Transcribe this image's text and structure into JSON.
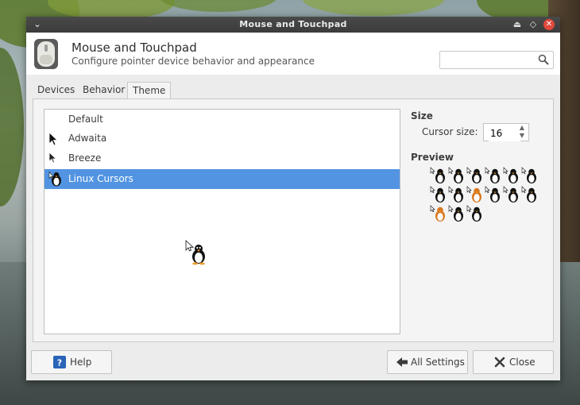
{
  "window": {
    "title": "Mouse and Touchpad"
  },
  "header": {
    "title": "Mouse and Touchpad",
    "subtitle": "Configure pointer device behavior and appearance",
    "search_value": "",
    "icon": "mouse-icon"
  },
  "tabs": [
    {
      "label": "Devices",
      "active": false
    },
    {
      "label": "Behavior",
      "active": false
    },
    {
      "label": "Theme",
      "active": true
    }
  ],
  "themes": [
    {
      "label": "Default",
      "cursor_icon": "none",
      "selected": false
    },
    {
      "label": "Adwaita",
      "cursor_icon": "arrow-cursor-icon",
      "selected": false
    },
    {
      "label": "Breeze",
      "cursor_icon": "arrow-cursor-icon",
      "selected": false
    },
    {
      "label": "Linux Cursors",
      "cursor_icon": "penguin-cursor-icon",
      "selected": true
    }
  ],
  "side": {
    "size_heading": "Size",
    "cursor_size_label": "Cursor size:",
    "cursor_size_value": "16",
    "preview_heading": "Preview"
  },
  "footer": {
    "help_label": "Help",
    "all_settings_label": "All Settings",
    "close_label": "Close"
  },
  "colors": {
    "selection": "#5294e2",
    "titlebar": "#3b3b3b",
    "close": "#e0493c"
  }
}
